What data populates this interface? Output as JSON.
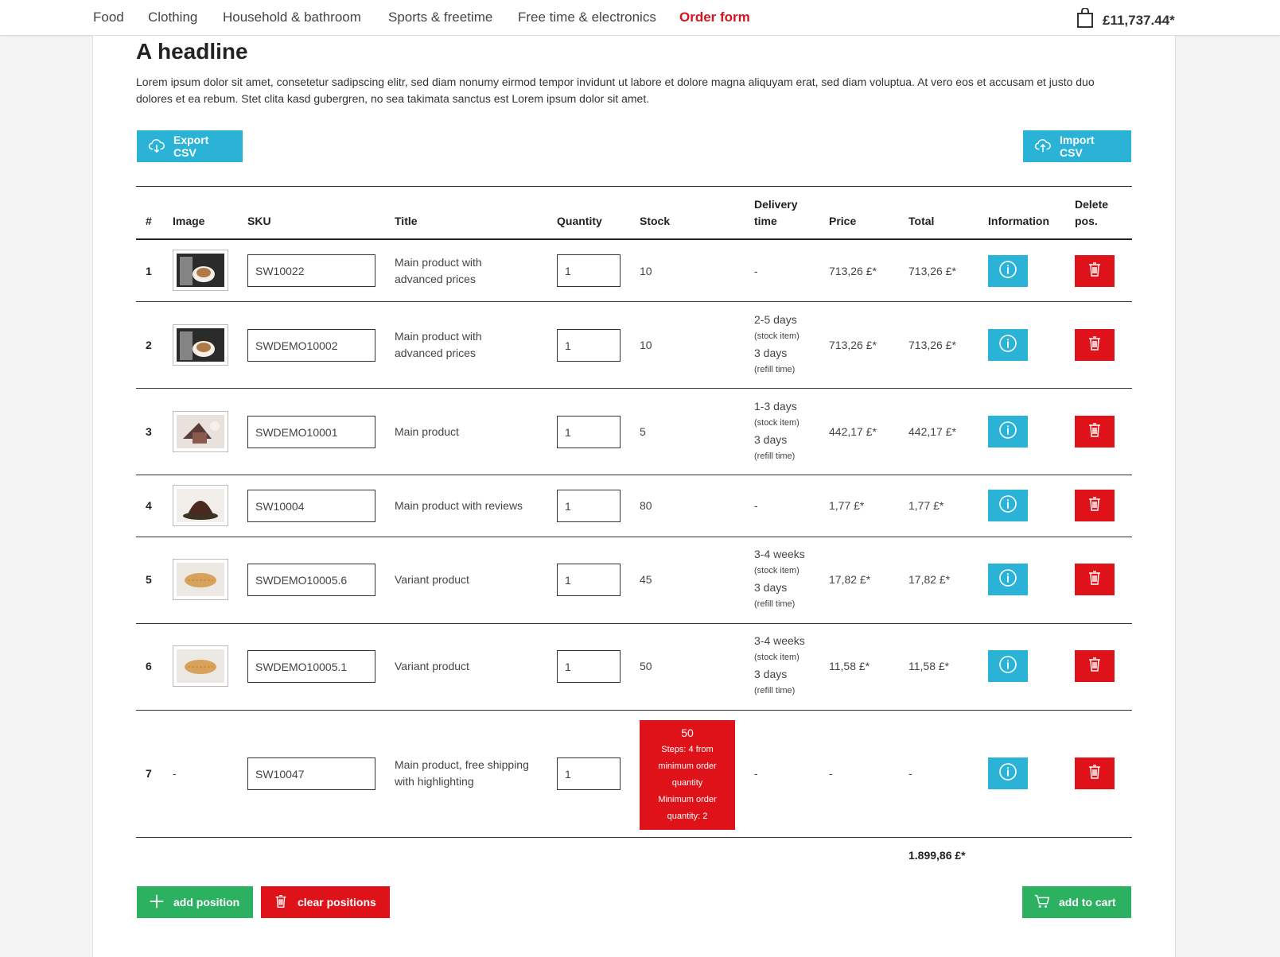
{
  "nav": {
    "items": [
      "Food",
      "Clothing",
      "Household & bathroom",
      "Sports & freetime",
      "Free time & electronics",
      "Order form"
    ],
    "active": "Order form",
    "cart_total": "£11,737.44*"
  },
  "page": {
    "headline": "A headline",
    "intro": "Lorem ipsum dolor sit amet, consetetur sadipscing elitr, sed diam nonumy eirmod tempor invidunt ut labore et dolore magna aliquyam erat, sed diam voluptua. At vero eos et accusam et justo duo dolores et ea rebum. Stet clita kasd gubergren, no sea takimata sanctus est Lorem ipsum dolor sit amet."
  },
  "actions": {
    "export_csv": "Export CSV",
    "import_csv": "Import CSV",
    "add_position": "add position",
    "clear_positions": "clear positions",
    "add_to_cart": "add to cart"
  },
  "table": {
    "headers": {
      "num": "#",
      "image": "Image",
      "sku": "SKU",
      "title": "Title",
      "quantity": "Quantity",
      "stock": "Stock",
      "delivery_1": "Delivery",
      "delivery_2": "time",
      "price": "Price",
      "total": "Total",
      "information": "Information",
      "delete_1": "Delete",
      "delete_2": "pos."
    },
    "rows": [
      {
        "num": "1",
        "image": "coffee",
        "sku": "SW10022",
        "title_1": "Main product with",
        "title_2": "advanced prices",
        "quantity": "1",
        "stock": "10",
        "delivery": "-",
        "price": "713,26 £*",
        "total": "713,26 £*"
      },
      {
        "num": "2",
        "image": "coffee",
        "sku": "SWDEMO10002",
        "title_1": "Main product with",
        "title_2": "advanced prices",
        "quantity": "1",
        "stock": "10",
        "d1": "2-5 days",
        "d1s": "(stock item)",
        "d2": "3 days",
        "d2s": "(refill time)",
        "price": "713,26 £*",
        "total": "713,26 £*"
      },
      {
        "num": "3",
        "image": "cake",
        "sku": "SWDEMO10001",
        "title": "Main product",
        "quantity": "1",
        "stock": "5",
        "d1": "1-3 days",
        "d1s": "(stock item)",
        "d2": "3 days",
        "d2s": "(refill time)",
        "price": "442,17 £*",
        "total": "442,17 £*"
      },
      {
        "num": "4",
        "image": "chocolate",
        "sku": "SW10004",
        "title": "Main product with reviews",
        "quantity": "1",
        "stock": "80",
        "delivery": "-",
        "price": "1,77 £*",
        "total": "1,77 £*"
      },
      {
        "num": "5",
        "image": "pastry",
        "sku": "SWDEMO10005.6",
        "title": "Variant product",
        "quantity": "1",
        "stock": "45",
        "d1": "3-4 weeks",
        "d1s": "(stock item)",
        "d2": "3 days",
        "d2s": "(refill time)",
        "price": "17,82 £*",
        "total": "17,82 £*"
      },
      {
        "num": "6",
        "image": "pastry",
        "sku": "SWDEMO10005.1",
        "title": "Variant product",
        "quantity": "1",
        "stock": "50",
        "d1": "3-4 weeks",
        "d1s": "(stock item)",
        "d2": "3 days",
        "d2s": "(refill time)",
        "price": "11,58 £*",
        "total": "11,58 £*"
      },
      {
        "num": "7",
        "image_text": "-",
        "sku": "SW10047",
        "title_1": "Main product, free shipping",
        "title_2": "with highlighting",
        "quantity": "1",
        "stock_warn": {
          "value": "50",
          "l1": "Steps: 4 from",
          "l2": "minimum order",
          "l3": "quantity",
          "l4": "Minimum order",
          "l5": "quantity: 2"
        },
        "delivery": "-",
        "price": "-",
        "total": "-"
      }
    ],
    "grand_total": "1.899,86 £*"
  },
  "colors": {
    "accent": "#2ab3d6",
    "danger": "#e01219",
    "success": "#2bb160",
    "active_nav": "#d8131b"
  }
}
